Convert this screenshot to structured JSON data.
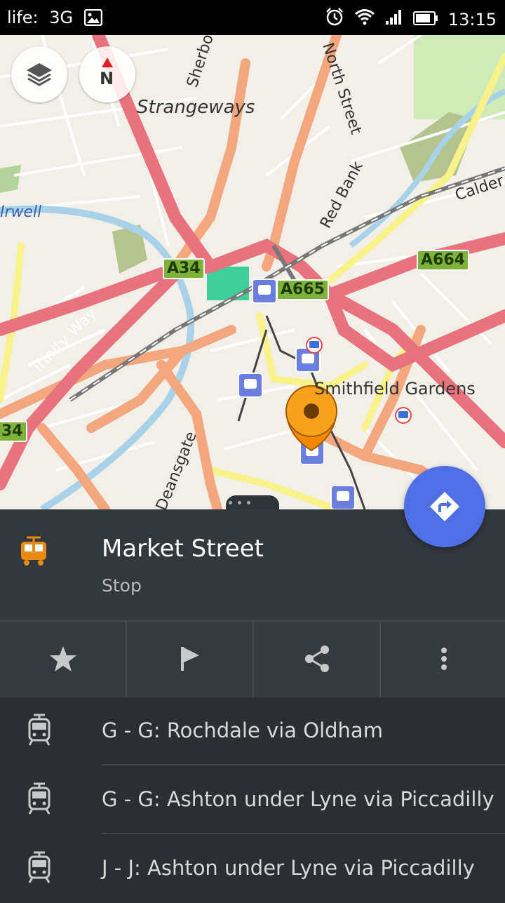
{
  "status_bar": {
    "carrier": "life:",
    "network": "3G",
    "time": "13:15"
  },
  "map": {
    "labels": {
      "strangeways": "Strangeways",
      "sherborne": "Sherborne St",
      "north_street": "North Street",
      "red_bank": "Red Bank",
      "irwell": "Irwell",
      "calder": "Calder",
      "trinity_way": "Trinity Way",
      "smithfield": "Smithfield Gardens",
      "deansgate": "Deansgate",
      "a34": "A34",
      "a34_left": "34",
      "a665": "A665",
      "a664": "A664"
    },
    "colors": {
      "background": "#f2efe9",
      "primary_road": "#e8727d",
      "secondary_road": "#f2a77e",
      "tertiary_road": "#f7f38a",
      "water": "#a7d2e8",
      "park": "#b5d29a",
      "shield_green": "#7fb23b",
      "bus_stop": "#6a7ee0",
      "marker": "#f28a00"
    }
  },
  "controls": {
    "layers_icon": "layers-icon",
    "compass_label": "N",
    "navigate_icon": "directions-icon"
  },
  "place": {
    "title": "Market Street",
    "type": "Stop",
    "icon": "tram-icon",
    "accent": "#e88a12"
  },
  "actions": [
    {
      "name": "favorite",
      "icon": "star-icon"
    },
    {
      "name": "flag",
      "icon": "flag-icon"
    },
    {
      "name": "share",
      "icon": "share-icon"
    },
    {
      "name": "more",
      "icon": "more-vertical-icon"
    }
  ],
  "routes": [
    {
      "label": "G - G: Rochdale via Oldham"
    },
    {
      "label": "G - G: Ashton under Lyne via Piccadilly"
    },
    {
      "label": "J - J: Ashton under Lyne via Piccadilly"
    }
  ]
}
